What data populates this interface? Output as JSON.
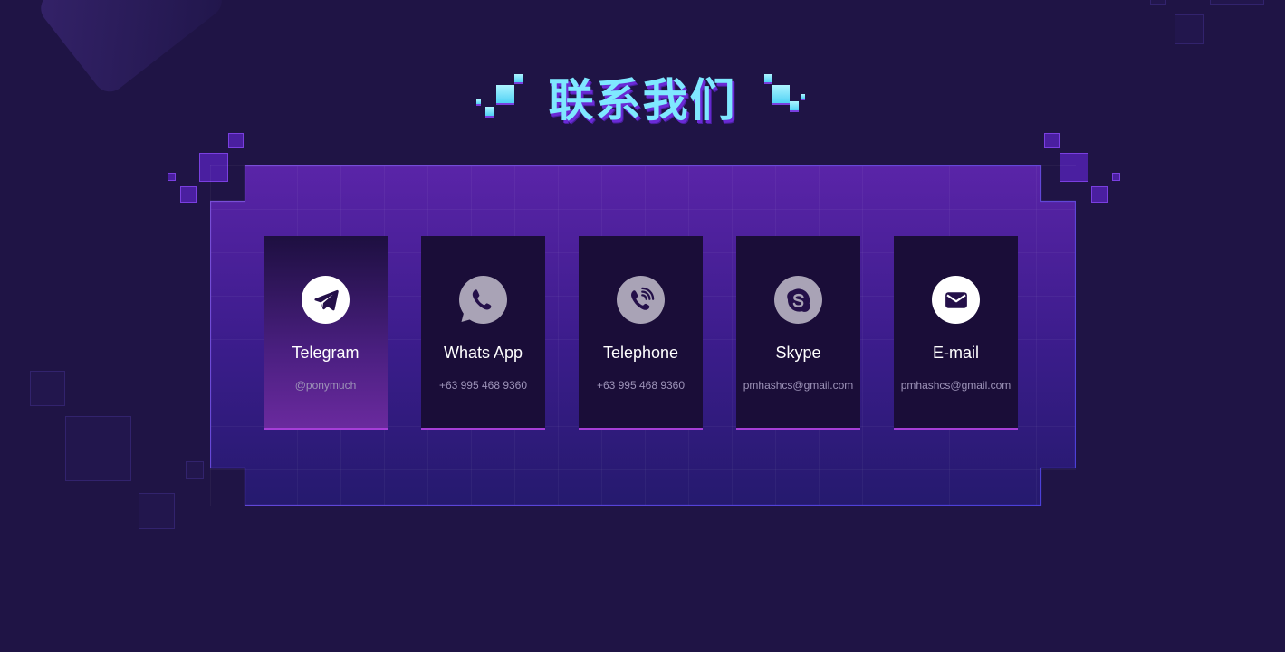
{
  "section": {
    "title": "联系我们"
  },
  "contacts": [
    {
      "label": "Telegram",
      "value": "@ponymuch",
      "icon": "telegram-icon",
      "active": true
    },
    {
      "label": "Whats App",
      "value": "+63 995 468 9360",
      "icon": "whatsapp-icon",
      "active": false
    },
    {
      "label": "Telephone",
      "value": "+63 995 468 9360",
      "icon": "phone-icon",
      "active": false
    },
    {
      "label": "Skype",
      "value": "pmhashcs@gmail.com",
      "icon": "skype-icon",
      "active": false
    },
    {
      "label": "E-mail",
      "value": "pmhashcs@gmail.com",
      "icon": "mail-icon",
      "active": false
    }
  ],
  "colors": {
    "background": "#1f1445",
    "title": "#7fe8ff",
    "accent": "#a63ed8",
    "card": "#1a0d38"
  }
}
